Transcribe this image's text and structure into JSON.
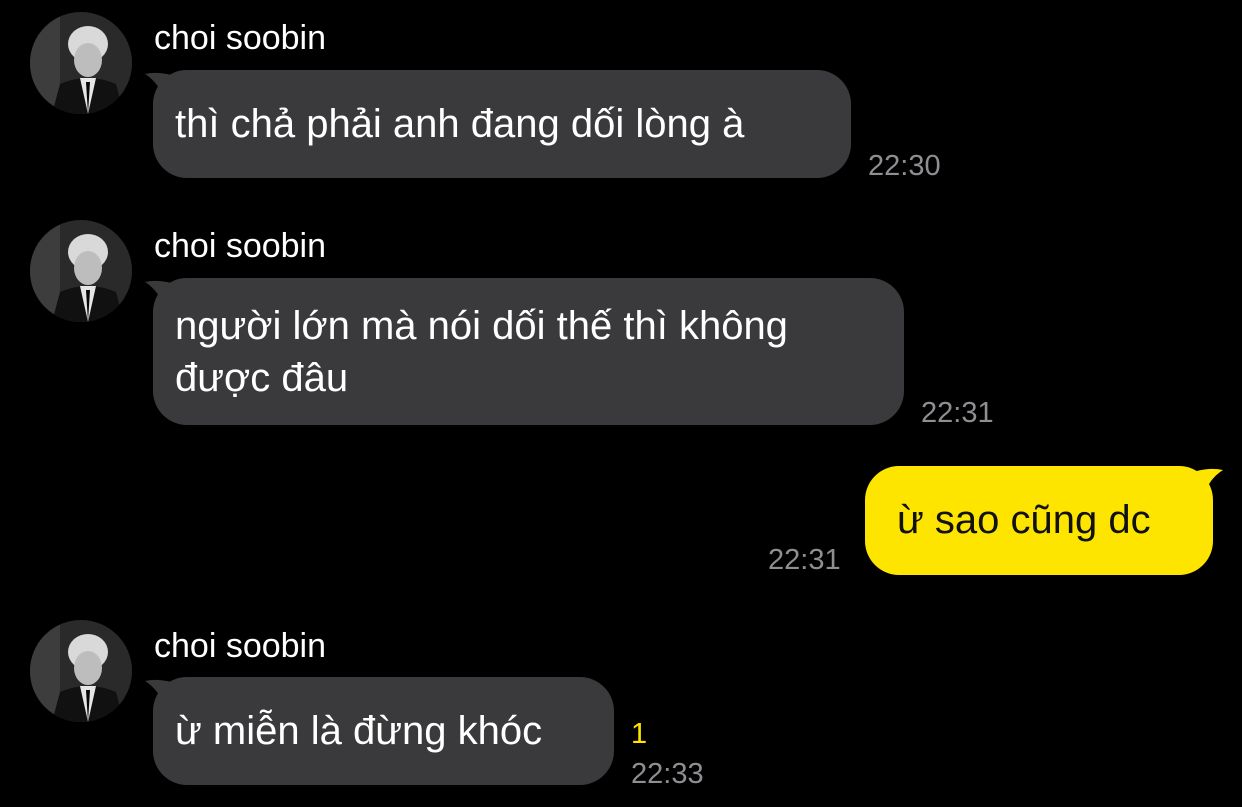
{
  "colors": {
    "background": "#000000",
    "incoming_bubble": "#3a3a3c",
    "outgoing_bubble": "#fee500",
    "timestamp": "#8e8e93",
    "unread_count": "#fee500"
  },
  "messages": [
    {
      "direction": "incoming",
      "sender": "choi soobin",
      "text": "thì chả phải anh đang dối lòng à",
      "time": "22:30",
      "avatar_icon": "profile-avatar"
    },
    {
      "direction": "incoming",
      "sender": "choi soobin",
      "text": "người lớn mà nói dối thế thì không được đâu",
      "time": "22:31",
      "avatar_icon": "profile-avatar"
    },
    {
      "direction": "outgoing",
      "text": "ừ sao cũng dc",
      "time": "22:31"
    },
    {
      "direction": "incoming",
      "sender": "choi soobin",
      "text": "ừ miễn là đừng khóc",
      "unread": "1",
      "time": "22:33",
      "avatar_icon": "profile-avatar"
    }
  ]
}
